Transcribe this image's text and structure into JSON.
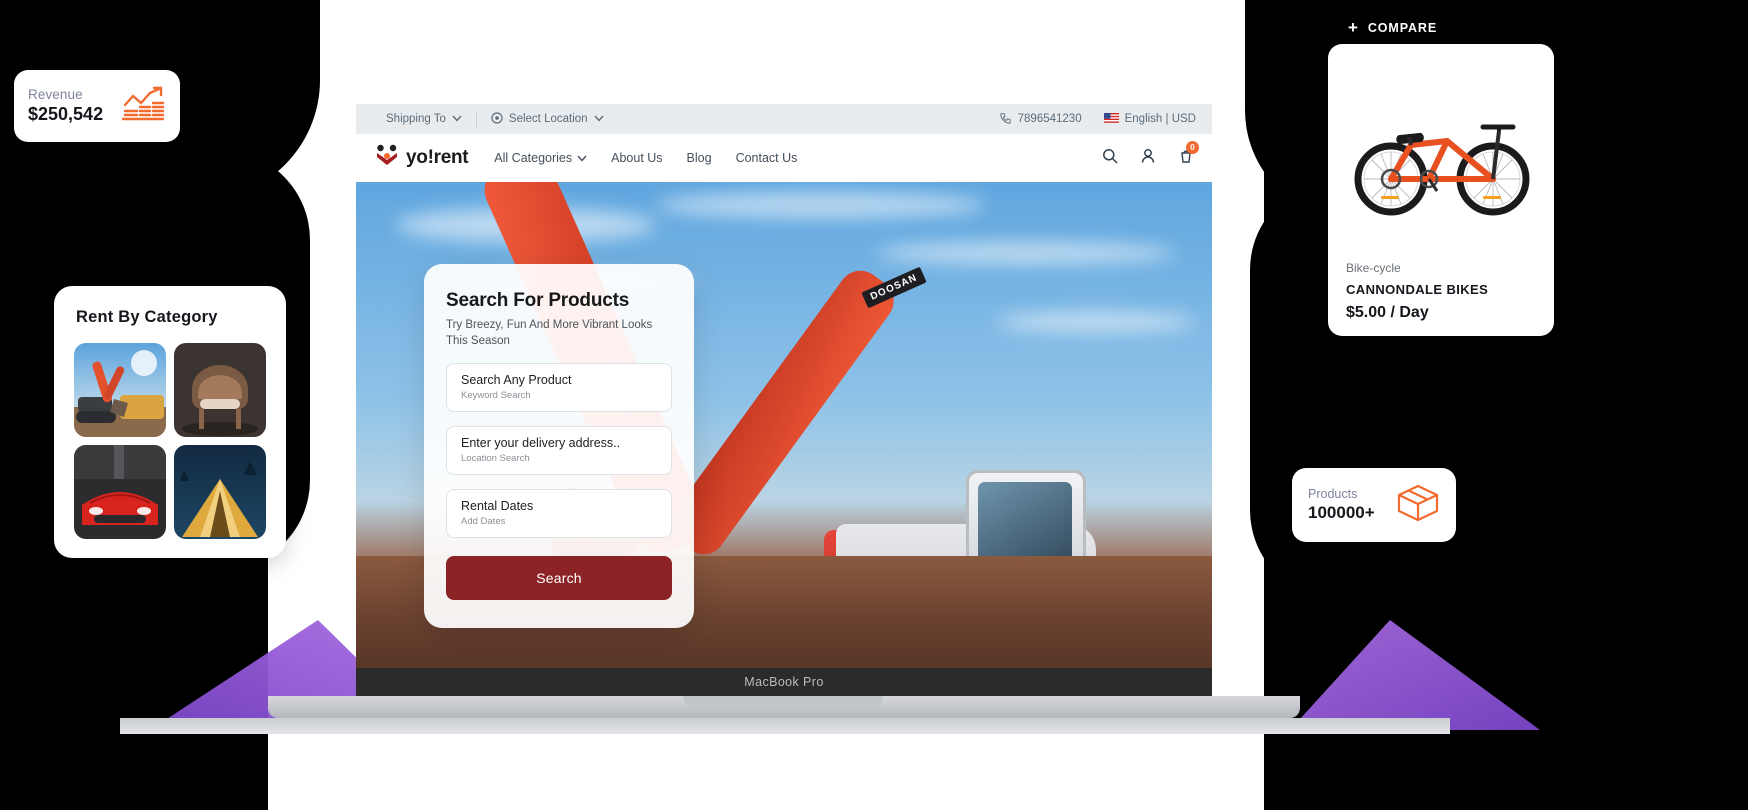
{
  "revenue_card": {
    "label": "Revenue",
    "value": "$250,542",
    "icon": "bar-chart-up-icon",
    "accent": "#f26a2e"
  },
  "category_card": {
    "title": "Rent By Category",
    "tiles": [
      {
        "name": "excavator-category-tile",
        "alt": "Heavy equipment excavator"
      },
      {
        "name": "furniture-category-tile",
        "alt": "Leather armchair"
      },
      {
        "name": "car-category-tile",
        "alt": "Red sports car"
      },
      {
        "name": "camping-category-tile",
        "alt": "Tent under night sky"
      }
    ]
  },
  "laptop": {
    "model_label": "MacBook Pro"
  },
  "site": {
    "topbar": {
      "shipping_to": "Shipping To",
      "select_location": "Select Location",
      "phone": "7896541230",
      "language_currency": "English | USD",
      "flag": "us-flag-icon"
    },
    "navbar": {
      "logo_text": "yo!rent",
      "links": [
        {
          "label": "All Categories",
          "has_chevron": true
        },
        {
          "label": "About Us",
          "has_chevron": false
        },
        {
          "label": "Blog",
          "has_chevron": false
        },
        {
          "label": "Contact Us",
          "has_chevron": false
        }
      ],
      "icons": [
        "search-icon",
        "user-icon",
        "cart-icon"
      ],
      "cart_count": "0",
      "cart_badge_color": "#f26a2e"
    },
    "hero": {
      "machine_brand": "DOOSAN"
    },
    "search_panel": {
      "title": "Search For Products",
      "subtitle": "Try Breezy, Fun And More Vibrant Looks This Season",
      "fields": [
        {
          "value": "Search Any Product",
          "placeholder": "Keyword Search",
          "name": "keyword-search-input"
        },
        {
          "value": "Enter your delivery address..",
          "placeholder": "Location Search",
          "name": "location-search-input"
        },
        {
          "value": "Rental Dates",
          "placeholder": "Add Dates",
          "name": "rental-dates-input"
        }
      ],
      "button_label": "Search",
      "button_color": "#8c2327"
    }
  },
  "compare": {
    "label": "COMPARE",
    "plus": "+"
  },
  "product_card": {
    "category": "Bike-cycle",
    "name": "CANNONDALE BIKES",
    "price": "$5.00 / Day",
    "image": "orange-mountain-bike"
  },
  "products_card": {
    "label": "Products",
    "value": "100000+",
    "icon": "box-package-icon",
    "accent": "#f26a2e"
  }
}
